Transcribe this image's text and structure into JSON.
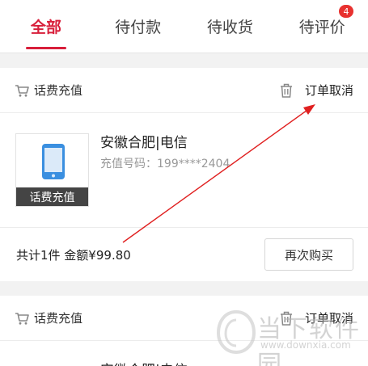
{
  "tabs": [
    {
      "label": "全部",
      "active": true
    },
    {
      "label": "待付款"
    },
    {
      "label": "待收货"
    },
    {
      "label": "待评价",
      "badge": "4"
    }
  ],
  "orders": [
    {
      "type": "话费充值",
      "status": "订单取消",
      "product": {
        "name": "安徽合肥|电信",
        "phone": "充值号码：199****2404",
        "tag": "话费充值"
      },
      "total": "共计1件 金额¥99.80",
      "rebuy_label": "再次购买"
    },
    {
      "type": "话费充值",
      "status": "订单取消",
      "product": {
        "name": "安徽合肥|电信"
      }
    }
  ],
  "watermark": {
    "name": "当下软件园",
    "url": "www.downxia.com"
  },
  "colors": {
    "accent": "#d81e3a",
    "badge": "#e8312f",
    "phone_icon": "#3a8fe0",
    "arrow": "#e02020"
  },
  "icons": [
    "cart-icon",
    "trash-icon",
    "phone-icon",
    "watermark-logo-icon"
  ]
}
